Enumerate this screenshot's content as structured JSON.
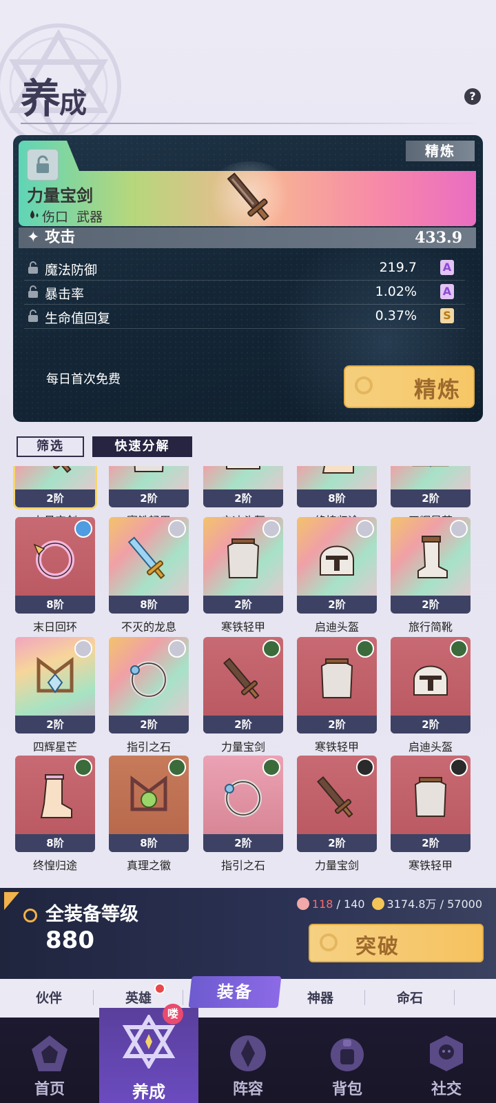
{
  "header": {
    "title_main": "养",
    "title_sub": "成",
    "help_label": "?"
  },
  "detail": {
    "refine_tag": "精炼",
    "item_name": "力量宝剑",
    "item_element": "伤口",
    "item_type": "武器",
    "main_stat": {
      "label": "攻击",
      "value": "433.9"
    },
    "sub_stats": [
      {
        "label": "魔法防御",
        "value": "219.7",
        "grade": "A"
      },
      {
        "label": "暴击率",
        "value": "1.02%",
        "grade": "A"
      },
      {
        "label": "生命值回复",
        "value": "0.37%",
        "grade": "S"
      }
    ],
    "free_text": "每日首次免费",
    "refine_button": "精炼"
  },
  "filters": {
    "filter_label": "筛选",
    "decompose_label": "快速分解"
  },
  "inventory": [
    {
      "name": "力量宝剑",
      "level": "2阶"
    },
    {
      "name": "寒铁轻甲",
      "level": "2阶"
    },
    {
      "name": "启迪头盔",
      "level": "2阶"
    },
    {
      "name": "终惶归途",
      "level": "8阶"
    },
    {
      "name": "四辉星芒",
      "level": "2阶"
    },
    {
      "name": "末日回环",
      "level": "8阶"
    },
    {
      "name": "不灭的龙息",
      "level": "8阶"
    },
    {
      "name": "寒铁轻甲",
      "level": "2阶"
    },
    {
      "name": "启迪头盔",
      "level": "2阶"
    },
    {
      "name": "旅行简靴",
      "level": "2阶"
    },
    {
      "name": "四辉星芒",
      "level": "2阶"
    },
    {
      "name": "指引之石",
      "level": "2阶"
    },
    {
      "name": "力量宝剑",
      "level": "2阶"
    },
    {
      "name": "寒铁轻甲",
      "level": "2阶"
    },
    {
      "name": "启迪头盔",
      "level": "2阶"
    },
    {
      "name": "终惶归途",
      "level": "8阶"
    },
    {
      "name": "真理之徽",
      "level": "8阶"
    },
    {
      "name": "指引之石",
      "level": "2阶"
    },
    {
      "name": "力量宝剑",
      "level": "2阶"
    },
    {
      "name": "寒铁轻甲",
      "level": "2阶"
    }
  ],
  "summary": {
    "label": "全装备等级",
    "value": "880",
    "gem_current": "118",
    "gem_max": "/ 140",
    "gold": "3174.8万 / 57000",
    "break_button": "突破"
  },
  "subtabs": [
    "伙伴",
    "英雄",
    "装备",
    "神器",
    "命石"
  ],
  "nav": {
    "items": [
      "首页",
      "养成",
      "阵容",
      "背包",
      "社交"
    ],
    "badge": "喽"
  },
  "colors": {
    "accent": "#6b4bbf",
    "gold": "#f6c25f",
    "panel": "#142636"
  }
}
